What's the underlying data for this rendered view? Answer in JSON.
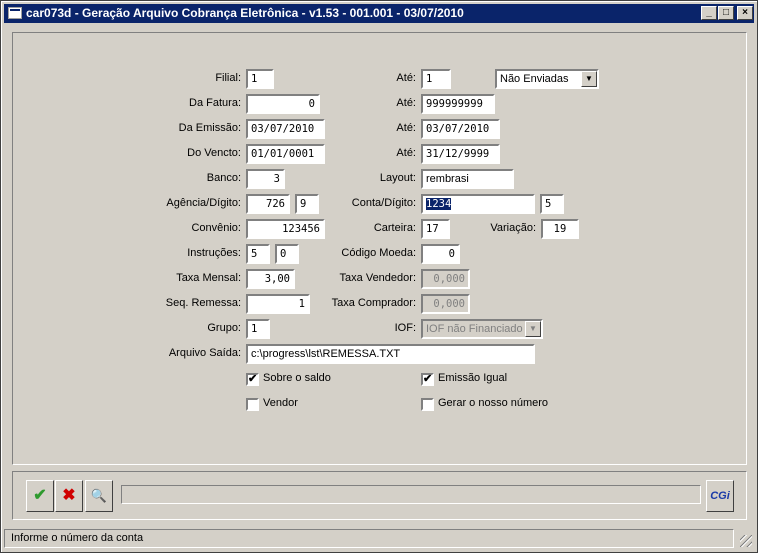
{
  "window": {
    "title": "car073d - Geração Arquivo Cobrança Eletrônica -  v1.53 - 001.001 - 03/07/2010",
    "minimize": "_",
    "maximize": "□",
    "close": "×"
  },
  "form": {
    "filial": {
      "label": "Filial:",
      "value": "1"
    },
    "filial_ate": {
      "label": "Até:",
      "value": "1"
    },
    "status_select": {
      "value": "Não Enviadas"
    },
    "da_fatura": {
      "label": "Da Fatura:",
      "value": "0"
    },
    "fatura_ate": {
      "label": "Até:",
      "value": "999999999"
    },
    "da_emissao": {
      "label": "Da Emissão:",
      "value": "03/07/2010"
    },
    "emissao_ate": {
      "label": "Até:",
      "value": "03/07/2010"
    },
    "do_vencto": {
      "label": "Do Vencto:",
      "value": "01/01/0001"
    },
    "vencto_ate": {
      "label": "Até:",
      "value": "31/12/9999"
    },
    "banco": {
      "label": "Banco:",
      "value": "3"
    },
    "layout": {
      "label": "Layout:",
      "value": "rembrasi"
    },
    "agencia": {
      "label": "Agência/Dígito:",
      "value": "726",
      "digito": "9"
    },
    "conta": {
      "label": "Conta/Dígito:",
      "value": "1234",
      "digito": "5"
    },
    "convenio": {
      "label": "Convênio:",
      "value": "123456"
    },
    "carteira": {
      "label": "Carteira:",
      "value": "17"
    },
    "variacao": {
      "label": "Variação:",
      "value": "19"
    },
    "instrucoes": {
      "label": "Instruções:",
      "value1": "5",
      "value2": "0"
    },
    "codigo_moeda": {
      "label": "Código Moeda:",
      "value": "0"
    },
    "taxa_mensal": {
      "label": "Taxa Mensal:",
      "value": "3,00"
    },
    "taxa_vendedor": {
      "label": "Taxa Vendedor:",
      "value": "0,000"
    },
    "seq_remessa": {
      "label": "Seq. Remessa:",
      "value": "1"
    },
    "taxa_comprador": {
      "label": "Taxa Comprador:",
      "value": "0,000"
    },
    "grupo": {
      "label": "Grupo:",
      "value": "1"
    },
    "iof": {
      "label": "IOF:",
      "value": "IOF não Financiado"
    },
    "arquivo_saida": {
      "label": "Arquivo Saída:",
      "value": "c:\\progress\\lst\\REMESSA.TXT"
    },
    "sobre_saldo": {
      "label": "Sobre o saldo",
      "checked": true,
      "mark": "✔"
    },
    "emissao_igual": {
      "label": "Emissão Igual",
      "checked": true,
      "mark": "✔"
    },
    "vendor": {
      "label": "Vendor",
      "checked": false,
      "mark": ""
    },
    "gerar_nosso_numero": {
      "label": "Gerar o nosso número",
      "checked": false,
      "mark": ""
    }
  },
  "toolbar": {
    "confirm_icon": "✔",
    "cancel_icon": "✖",
    "search_icon": "🔍",
    "logo": "CGi"
  },
  "status": {
    "text": "Informe o número da conta"
  }
}
